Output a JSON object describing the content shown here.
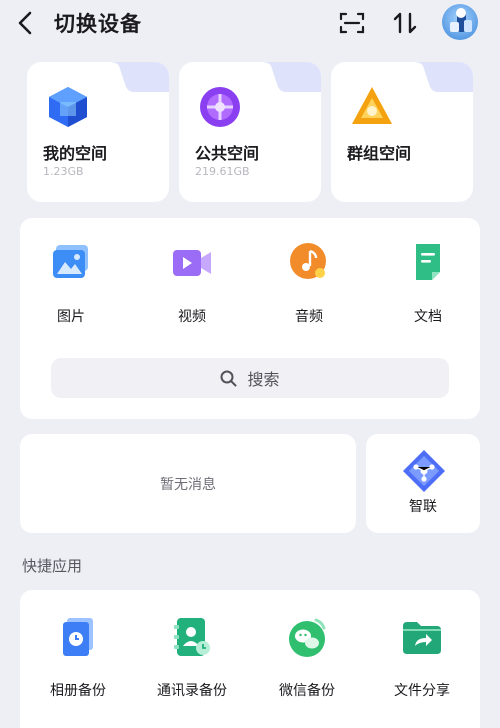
{
  "header": {
    "title": "切换设备",
    "back_icon": "chevron-left-icon",
    "scan_icon": "scan-icon",
    "sort_icon": "sort-icon",
    "avatar": "avatar"
  },
  "spaces": [
    {
      "name": "我的空间",
      "size": "1.23GB",
      "icon": "cube-icon",
      "color": "#2f6cf3"
    },
    {
      "name": "公共空间",
      "size": "219.61GB",
      "icon": "globe-icon",
      "color": "#8a3ff0"
    },
    {
      "name": "群组空间",
      "size": "",
      "icon": "triangle-icon",
      "color": "#f4a20f"
    }
  ],
  "media": [
    {
      "label": "图片",
      "icon": "image-icon",
      "color": "#3d8df6"
    },
    {
      "label": "视频",
      "icon": "video-icon",
      "color": "#9b6cf5"
    },
    {
      "label": "音频",
      "icon": "music-icon",
      "color": "#f28b2a"
    },
    {
      "label": "文档",
      "icon": "document-icon",
      "color": "#2fbf86"
    }
  ],
  "search": {
    "placeholder": "搜索"
  },
  "notice": {
    "text": "暂无消息"
  },
  "zhilian": {
    "label": "智联",
    "icon": "network-icon"
  },
  "quick_apps": {
    "title": "快捷应用",
    "items": [
      {
        "label": "相册备份",
        "icon": "album-backup-icon",
        "color": "#3d7ef6"
      },
      {
        "label": "通讯录备份",
        "icon": "contacts-backup-icon",
        "color": "#22b07c"
      },
      {
        "label": "微信备份",
        "icon": "wechat-backup-icon",
        "color": "#2fbf6f"
      },
      {
        "label": "文件分享",
        "icon": "file-share-icon",
        "color": "#22a878"
      }
    ]
  }
}
